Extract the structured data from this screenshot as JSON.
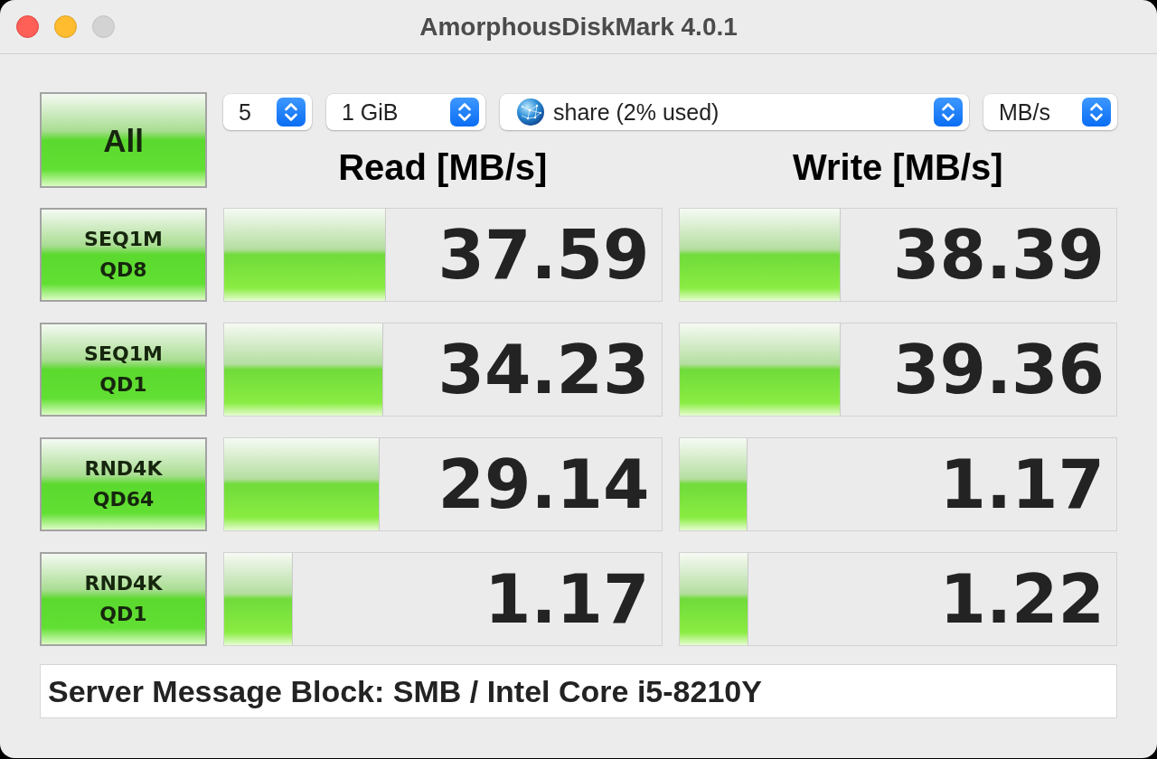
{
  "window": {
    "title": "AmorphousDiskMark 4.0.1",
    "zoom_disabled": true
  },
  "all_button": {
    "label": "All"
  },
  "selects": [
    {
      "kind": "plain",
      "value": "5"
    },
    {
      "kind": "plain",
      "value": "1 GiB"
    },
    {
      "kind": "drive",
      "value": "share (2% used)"
    },
    {
      "kind": "plain",
      "value": "MB/s"
    }
  ],
  "columns": [
    "Read [MB/s]",
    "Write [MB/s]"
  ],
  "tests": [
    {
      "name": "SEQ1M",
      "queue": "QD8",
      "read": {
        "value": "37.59",
        "level": 0.37
      },
      "write": {
        "value": "38.39",
        "level": 0.37
      }
    },
    {
      "name": "SEQ1M",
      "queue": "QD1",
      "read": {
        "value": "34.23",
        "level": 0.365
      },
      "write": {
        "value": "39.36",
        "level": 0.37
      }
    },
    {
      "name": "RND4K",
      "queue": "QD64",
      "read": {
        "value": "29.14",
        "level": 0.355
      },
      "write": {
        "value": "1.17",
        "level": 0.157
      }
    },
    {
      "name": "RND4K",
      "queue": "QD1",
      "read": {
        "value": "1.17",
        "level": 0.157
      },
      "write": {
        "value": "1.22",
        "level": 0.159
      }
    }
  ],
  "info_field": {
    "value": "Server Message Block: SMB / Intel Core i5-8210Y"
  }
}
